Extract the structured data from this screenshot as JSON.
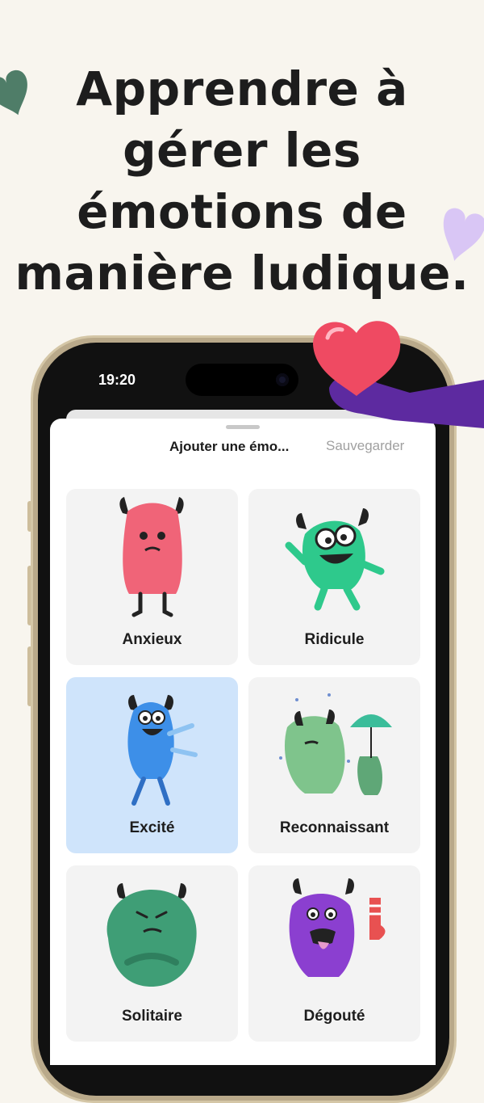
{
  "headline": {
    "line1": "Apprendre à",
    "line2": "gérer les",
    "line3": "émotions de",
    "line4": "manière ludique."
  },
  "status_bar": {
    "time": "19:20"
  },
  "sheet": {
    "title": "Ajouter une émo...",
    "save_label": "Sauvegarder"
  },
  "emotions": [
    {
      "label": "Anxieux",
      "color": "#f06478",
      "selected": false
    },
    {
      "label": "Ridicule",
      "color": "#2ec98c",
      "selected": false
    },
    {
      "label": "Excité",
      "color": "#3d8fe8",
      "selected": true
    },
    {
      "label": "Reconnaissant",
      "color": "#7fc48c",
      "selected": false
    },
    {
      "label": "Solitaire",
      "color": "#3f9e76",
      "selected": false
    },
    {
      "label": "Dégouté",
      "color": "#8b3fd0",
      "selected": false
    }
  ],
  "colors": {
    "background": "#f8f5ee",
    "selected_card": "#cfe4fb",
    "heart_pink": "#ef4a62",
    "heart_green": "#4f7d68",
    "heart_lilac": "#d9c6f5",
    "arm_purple": "#5d2aa0"
  },
  "icons": [
    "heart-icon",
    "monster-illustration"
  ]
}
